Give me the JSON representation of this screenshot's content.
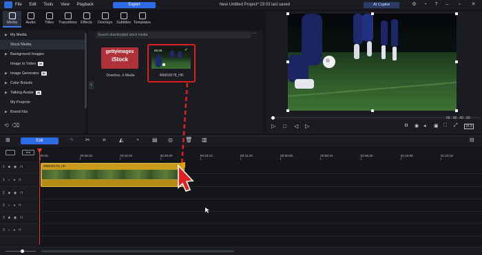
{
  "titlebar": {
    "menu": [
      "File",
      "Edit",
      "Tools",
      "View",
      "Playback"
    ],
    "export_label": "Export",
    "project_title": "New Untitled Project* 23:03 last saved",
    "copilot_label": "AI Copilot"
  },
  "tabs": [
    {
      "label": "Media",
      "active": true
    },
    {
      "label": "Audio"
    },
    {
      "label": "Titles"
    },
    {
      "label": "Transitions"
    },
    {
      "label": "Effects"
    },
    {
      "label": "Overlays"
    },
    {
      "label": "Subtitles"
    },
    {
      "label": "Templates"
    }
  ],
  "nav": {
    "items": [
      {
        "label": "My Media",
        "caret": "▶"
      },
      {
        "label": "Stock Media",
        "selected": true
      },
      {
        "label": "Background Images",
        "caret": "▶"
      },
      {
        "label": "Image to Video",
        "badge": "AI"
      },
      {
        "label": "Image Generator",
        "caret": "▶",
        "badge": "AI"
      },
      {
        "label": "Color Boards",
        "caret": "▶"
      },
      {
        "label": "Talking Avatar",
        "caret": "▶",
        "badge": "AI"
      },
      {
        "label": "My Projects"
      },
      {
        "label": "Brand Kits",
        "caret": "▶"
      }
    ]
  },
  "media": {
    "search_placeholder": "Search downloaded stock media",
    "getty_line1": "gettyimages",
    "getty_line2": "iStock",
    "getty_label": "Downloa...k Media",
    "clip_duration": "00:28",
    "clip_label": "496818178_HD"
  },
  "preview": {
    "timecode": "00 : 00 : 00 : 00",
    "ratio": "16:9"
  },
  "timeline": {
    "edit_label": "Edit",
    "ticks": [
      "00:00",
      "00:08:10",
      "00:16:20",
      "00:25:00",
      "00:33:10",
      "00:41:20",
      "00:50:00",
      "00:58:10",
      "01:06:20",
      "01:15:00",
      "01:23:10"
    ],
    "clip_name": "496818178_HD",
    "tracks": [
      "1",
      "1",
      "2",
      "2",
      "3",
      "3"
    ]
  },
  "colors": {
    "accent": "#2e6be6",
    "highlight": "#e02020",
    "clip": "#c99b1c"
  }
}
